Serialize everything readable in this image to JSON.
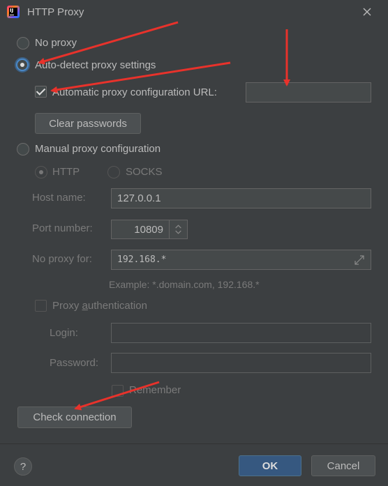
{
  "window": {
    "title": "HTTP Proxy",
    "close_icon": "close-icon",
    "app_icon_text": "IJ"
  },
  "modes": {
    "no_proxy": "No proxy",
    "auto_detect": "Auto-detect proxy settings",
    "manual": "Manual proxy configuration",
    "selected": "auto_detect"
  },
  "auto": {
    "pac_checkbox_label": "Automatic proxy configuration URL:",
    "pac_checked": true,
    "pac_url": "",
    "clear_passwords": "Clear passwords"
  },
  "manual": {
    "protocol_http": "HTTP",
    "protocol_socks": "SOCKS",
    "host_label": "Host name:",
    "host_value": "127.0.0.1",
    "port_label": "Port number:",
    "port_value": "10809",
    "no_proxy_label": "No proxy for:",
    "no_proxy_value": "192.168.*",
    "example": "Example: *.domain.com, 192.168.*",
    "auth_label_pre": "Proxy ",
    "auth_label_mnemonic": "a",
    "auth_label_post": "uthentication",
    "login_label": "Login:",
    "login_value": "",
    "password_label": "Password:",
    "password_value": "",
    "remember": "Remember"
  },
  "footer": {
    "check_connection": "Check connection",
    "help": "?",
    "ok": "OK",
    "cancel": "Cancel"
  },
  "colors": {
    "accent": "#365880",
    "annotation": "#e8322b",
    "background": "#3c3f41"
  }
}
